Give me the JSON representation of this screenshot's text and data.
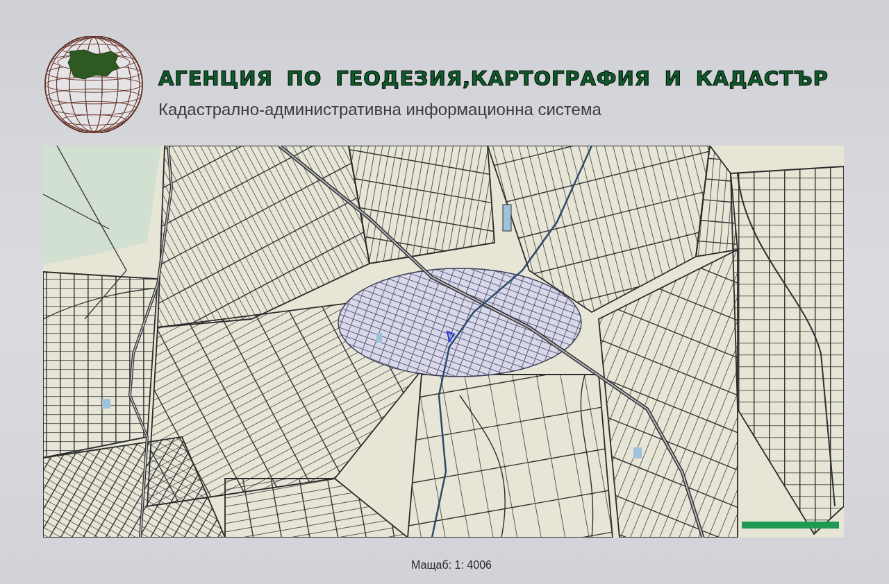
{
  "header": {
    "title": "АГЕНЦИЯ ПО ГЕОДЕЗИЯ,КАРТОГРАФИЯ И КАДАСТЪР",
    "subtitle": "Кадастрално-административна информационна система"
  },
  "scale_label": "Мащаб: 1: 4006"
}
